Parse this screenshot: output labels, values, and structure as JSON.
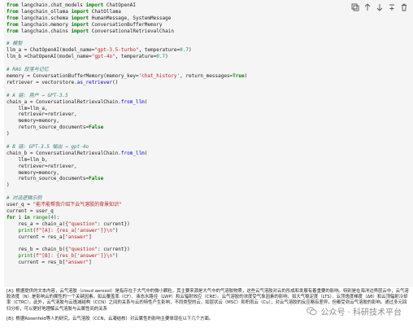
{
  "toolbar": {
    "icons": [
      "copy-icon",
      "arrow-up-icon",
      "arrow-down-icon",
      "insert-below-icon",
      "delete-icon"
    ]
  },
  "code": {
    "l01": [
      "from",
      " langchain.chat_models ",
      "import",
      " ChatOpenAI"
    ],
    "l02": [
      "from",
      " langchain_ollama ",
      "import",
      " ChatOllama"
    ],
    "l03": [
      "from",
      " langchain.schema ",
      "import",
      " HumanMessage, SystemMessage"
    ],
    "l04": [
      "from",
      " langchain.memory ",
      "import",
      " ConversationBufferMemory"
    ],
    "l05": [
      "from",
      " langchain.chains ",
      "import",
      " ConversationalRetrievalChain"
    ],
    "l07": "# 模型",
    "l08": [
      "llm_a = ChatOpenAI(model_name=",
      "\"gpt-3.5-turbo\"",
      ", temperature=",
      "0.7",
      ")"
    ],
    "l09": [
      "llm_b =ChatOpenAI(model_name=",
      "\"gpt-4o\"",
      ", temperature=",
      "0.7",
      ")"
    ],
    "l11": "# RAG 段落与记忆",
    "l12": [
      "memory = ConversationBufferMemory(memory_key=",
      "'chat_history'",
      ", return_messages=",
      "True",
      ")"
    ],
    "l13": [
      "retriever = vectorstore.",
      "as_retriever",
      "()"
    ],
    "l15": "# A 链: 用户 → GPT-3.5",
    "l16": [
      "chain_a = ConversationalRetrievalChain.",
      "from_llm",
      "("
    ],
    "l17": "    llm=llm_a,",
    "l18": "    retriever=retriever,",
    "l19": "    memory=memory,",
    "l20": [
      "    return_source_documents=",
      "False"
    ],
    "l21": ")",
    "l23": "# B 链: GPT-3.5 输出 → gpt-4o",
    "l24": [
      "chain_b = ConversationalRetrievalChain.",
      "from_llm",
      "("
    ],
    "l25": "    llm=llm_b,",
    "l26": "    retriever=retriever,",
    "l27": "    memory=memory,",
    "l28": [
      "    return_source_documents=",
      "False"
    ],
    "l29": ")",
    "l31": "# 对话逻辑示例",
    "l32": [
      "user_q = ",
      "\"能不能帮我介绍下云气溶胶的背景知识\""
    ],
    "l33": "current = user_q",
    "l34": [
      "for",
      " i ",
      "in",
      " ",
      "range",
      "(",
      "4",
      "):"
    ],
    "l35": [
      "    res_a = chain_a({",
      "\"question\"",
      ": current})"
    ],
    "l36": [
      "    ",
      "print",
      "(",
      "f\"[A]: {res_a[",
      "'answer'",
      "]}\\n\"",
      ")"
    ],
    "l37": [
      "    current = res_a[",
      "\"answer\"",
      "]"
    ],
    "l39": [
      "    res_b = chain_b({",
      "\"question\"",
      ": current})"
    ],
    "l40": [
      "    ",
      "print",
      "(",
      "f\"[B]: {res_b[",
      "'answer'",
      "]}\\n\"",
      ")"
    ],
    "l41": [
      "    current = res_b[",
      "\"answer\"",
      "]"
    ]
  },
  "output": {
    "a": "[A]: 根据提供的文本内容，云气溶胶（cloud aerosol）是指存在于大气中的微小颗粒，其主要来源是大气中的气溶胶物质，这些云气溶胶对云的形成和发展有着重要的影响。特别是在海洋边界层云中，云气溶胶浓度（N）是影响云的属性的一个关键因素。如云覆盖率（CF）、液态水路径（LWP）和云辐射效应（CRE）。云气溶胶的浓度受气象因素的影响，如大气稳定度（LTS）、云顶逸度梯度（Δθ）和云顶辐射冷却率（CTRC）。此外，云气溶胶与云逸减结构（CCN）之间的关系与云的特性产生影响，不同类型的云，如层状云（MSC）和积雨云（Cu），对云气溶胶的反应略有差异，但都受到云气溶胶的影响。通过多元回归分析，可以更好地理解云气溶胶与云属性间的关系",
    "b": "[B]: 根据Rosenfeld等人的研究，云气溶胶（CCN，云凝结核）对云属性的影响主要体现在以下几个方面。"
  },
  "watermark": {
    "text": "公众号 · 科研技术平台"
  }
}
